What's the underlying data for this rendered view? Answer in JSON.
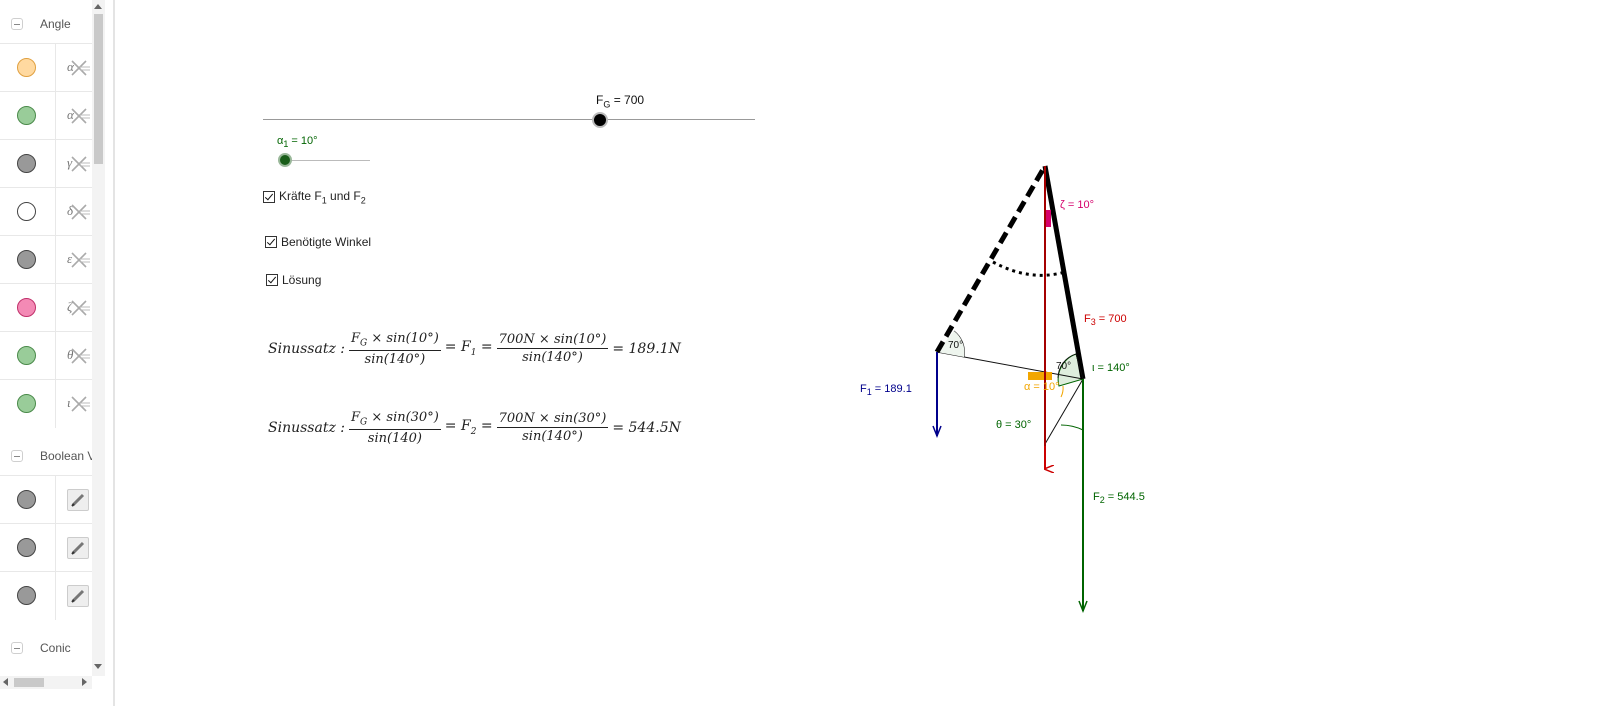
{
  "sidebar": {
    "sections": [
      {
        "title": "Angle",
        "rows": [
          {
            "color": "#ffd9a0",
            "border": "#e0a040",
            "label": "α"
          },
          {
            "color": "#99cc99",
            "border": "#4a8a4a",
            "label": "α"
          },
          {
            "color": "#999999",
            "border": "#444444",
            "label": "γ"
          },
          {
            "color": "#ffffff",
            "border": "#444444",
            "label": "δ"
          },
          {
            "color": "#999999",
            "border": "#444444",
            "label": "ε"
          },
          {
            "color": "#f38ab5",
            "border": "#c0306a",
            "label": "ζ"
          },
          {
            "color": "#99cc99",
            "border": "#4a8a4a",
            "label": "θ"
          },
          {
            "color": "#99cc99",
            "border": "#4a8a4a",
            "label": "ι"
          }
        ]
      },
      {
        "title": "Boolean V",
        "rows": [
          {
            "color": "#999999",
            "border": "#444444",
            "label": ""
          },
          {
            "color": "#999999",
            "border": "#444444",
            "label": ""
          },
          {
            "color": "#999999",
            "border": "#444444",
            "label": ""
          }
        ]
      },
      {
        "title": "Conic",
        "rows": []
      }
    ]
  },
  "sliders": {
    "fg": {
      "label": "F",
      "sub": "G",
      "value_text": " = 700",
      "value": 700,
      "fraction": 0.685
    },
    "alpha1": {
      "label": "α",
      "sub": "1",
      "value_text": " = 10°",
      "value": 10,
      "fraction": 0.06,
      "color": "#006400"
    }
  },
  "checkboxes": [
    {
      "id": "forces",
      "label_parts": [
        "Kräfte F",
        "1",
        " und F",
        "2"
      ],
      "checked": true
    },
    {
      "id": "angles",
      "label": "Benötigte Winkel",
      "checked": true
    },
    {
      "id": "solution",
      "label": "Lösung",
      "checked": true
    }
  ],
  "formulas": [
    {
      "prefix": "Sinussatz :",
      "num1": "F",
      "num1_sub": "G",
      "num1_rest": " × sin(10°)",
      "den1": "sin(140°)",
      "mid": "= F",
      "mid_sub": "1",
      "num2": "700N × sin(10°)",
      "den2": "sin(140°)",
      "result": "= 189.1N"
    },
    {
      "prefix": "Sinussatz :",
      "num1": "F",
      "num1_sub": "G",
      "num1_rest": " × sin(30°)",
      "den1": "sin(140)",
      "mid": "= F",
      "mid_sub": "2",
      "num2": "700N × sin(30°)",
      "den2": "sin(140°)",
      "result": "= 544.5N"
    }
  ],
  "diagram": {
    "labels": {
      "zeta": "ζ = 10°",
      "f3_main": "F",
      "f3_sub": "3",
      "f3_val": " = 700",
      "iota": "ι = 140°",
      "f1_main": "F",
      "f1_sub": "1",
      "f1_val": " = 189.1",
      "alpha": "α = 10°",
      "theta": "θ = 30°",
      "f2_main": "F",
      "f2_sub": "2",
      "f2_val": " = 544.5",
      "angle70a": "70°",
      "angle70b": "70°"
    },
    "colors": {
      "red": "#cc0000",
      "blue": "#00008b",
      "green": "#006400",
      "magenta": "#d6006b",
      "orange": "#f2a600"
    }
  }
}
